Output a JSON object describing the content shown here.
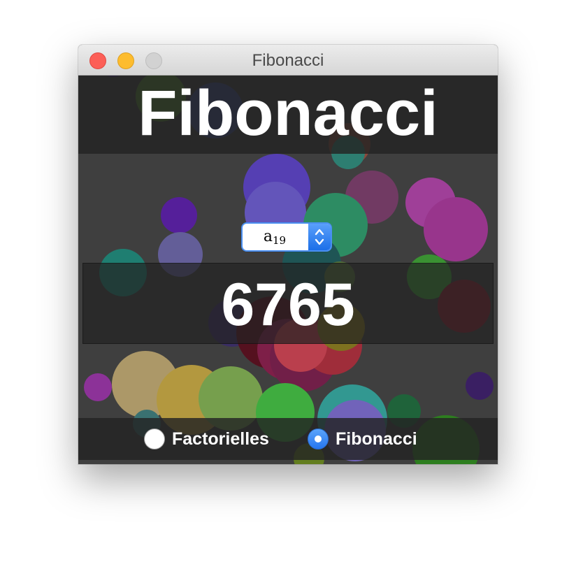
{
  "window": {
    "title": "Fibonacci"
  },
  "header": {
    "title": "Fibonacci"
  },
  "selector": {
    "base": "a",
    "index": "19"
  },
  "result": {
    "value": "6765"
  },
  "modes": [
    {
      "label": "Factorielles",
      "selected": false
    },
    {
      "label": "Fibonacci",
      "selected": true
    }
  ],
  "colors": {
    "accent": "#2676ee",
    "close": "#fc5f57",
    "minimize": "#fdbc2e",
    "zoom": "#d2d2d2"
  }
}
